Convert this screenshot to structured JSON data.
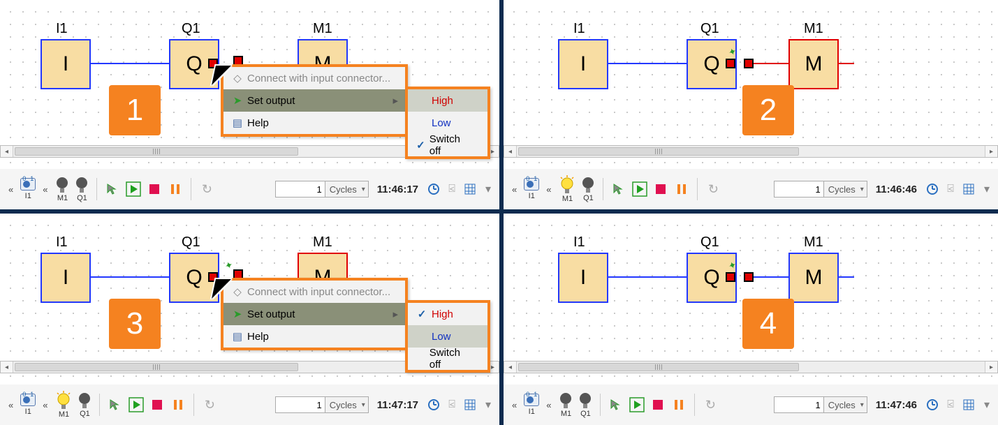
{
  "divider_color": "#0d2b4f",
  "accent_color": "#f58220",
  "blocks": {
    "i": "I",
    "q": "Q",
    "m": "M"
  },
  "labels": {
    "i": "I1",
    "q": "Q1",
    "m": "M1"
  },
  "badge": {
    "p1": "1",
    "p2": "2",
    "p3": "3",
    "p4": "4"
  },
  "context_menu": {
    "connect": "Connect with input connector...",
    "set_output": "Set output",
    "help": "Help",
    "submenu": {
      "high": "High",
      "low": "Low",
      "switch_off": "Switch off"
    }
  },
  "toolbar": {
    "cycles_value": "1",
    "cycles_label": "Cycles",
    "io_i": "I1",
    "io_m": "M1",
    "io_q": "Q1"
  },
  "times": {
    "p1": "11:46:17",
    "p2": "11:46:46",
    "p3": "11:47:17",
    "p4": "11:47:46"
  }
}
